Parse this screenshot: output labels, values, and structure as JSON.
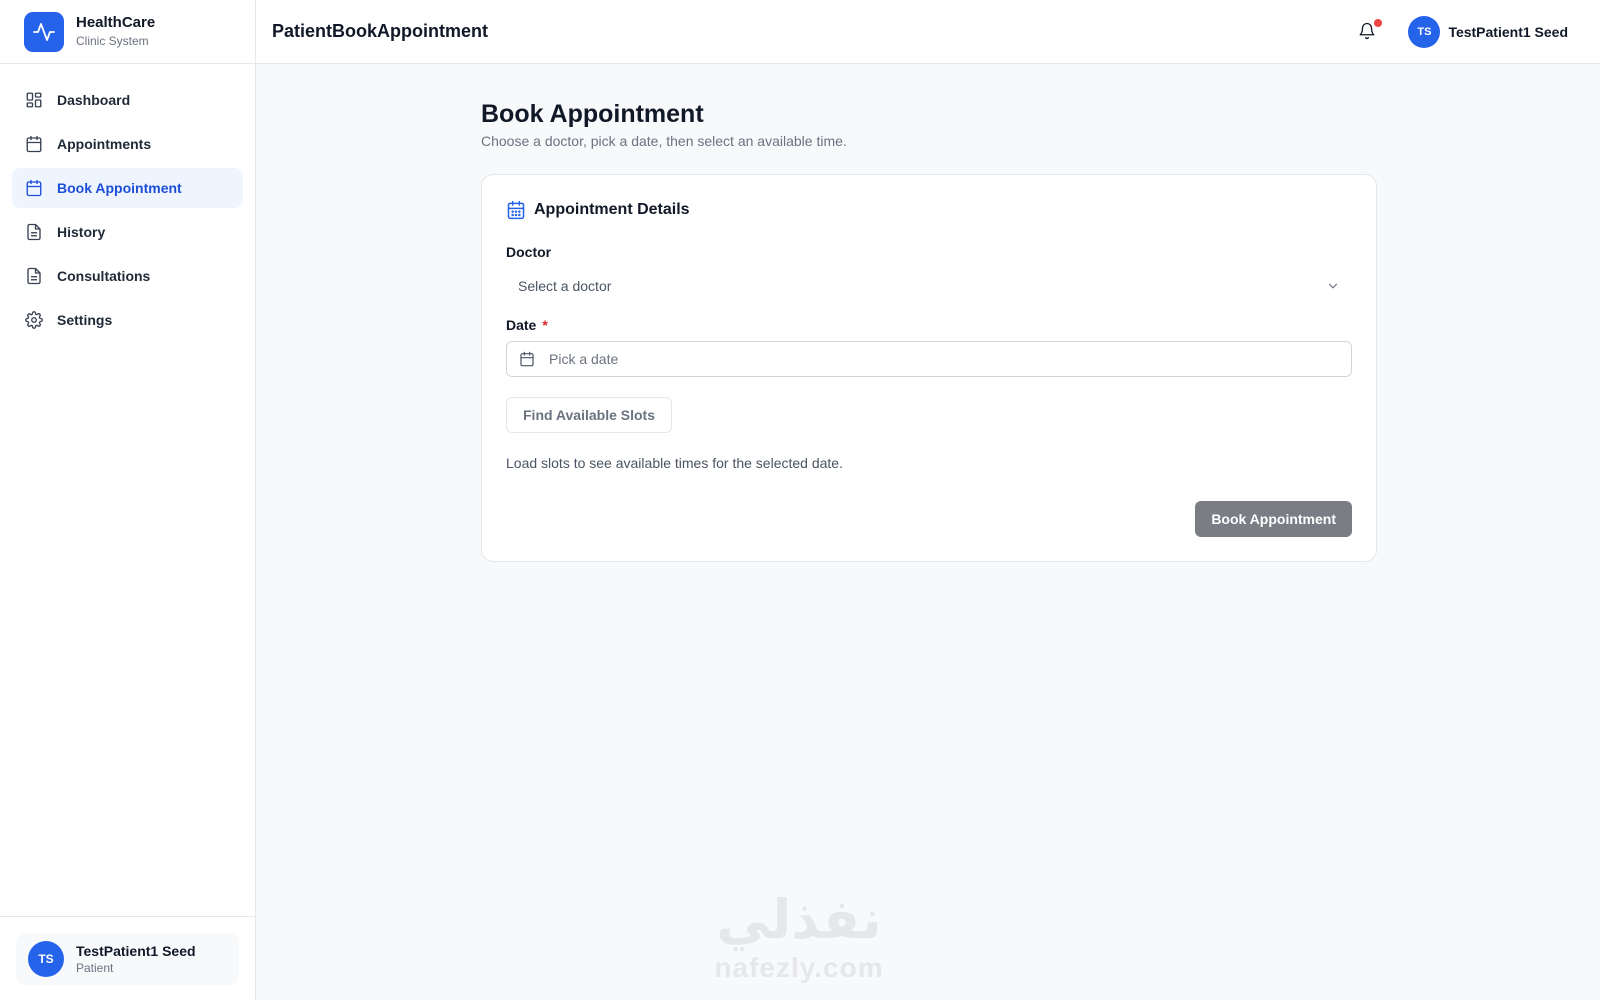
{
  "brand": {
    "title": "HealthCare",
    "subtitle": "Clinic System",
    "icon": "activity-icon"
  },
  "sidebar": {
    "items": [
      {
        "label": "Dashboard",
        "icon": "dashboard-grid-icon",
        "active": false
      },
      {
        "label": "Appointments",
        "icon": "calendar-icon",
        "active": false
      },
      {
        "label": "Book Appointment",
        "icon": "calendar-icon",
        "active": true
      },
      {
        "label": "History",
        "icon": "document-icon",
        "active": false
      },
      {
        "label": "Consultations",
        "icon": "document-icon",
        "active": false
      },
      {
        "label": "Settings",
        "icon": "gear-icon",
        "active": false
      }
    ],
    "user": {
      "initials": "TS",
      "name": "TestPatient1 Seed",
      "role": "Patient"
    }
  },
  "header": {
    "title": "PatientBookAppointment",
    "user": {
      "initials": "TS",
      "name": "TestPatient1 Seed"
    }
  },
  "page": {
    "title": "Book Appointment",
    "subtitle": "Choose a doctor, pick a date, then select an available time."
  },
  "card": {
    "title": "Appointment Details",
    "doctor_label": "Doctor",
    "doctor_placeholder": "Select a doctor",
    "date_label": "Date",
    "date_required": "*",
    "date_placeholder": "Pick a date",
    "find_button": "Find Available Slots",
    "hint": "Load slots to see available times for the selected date.",
    "book_button": "Book Appointment"
  },
  "watermark": {
    "arabic": "نفذلي",
    "latin": "nafezly.com"
  },
  "colors": {
    "accent": "#2563eb",
    "active_bg": "#eff5ff",
    "notification_dot": "#ef4444",
    "disabled_button": "#7b7d85"
  }
}
